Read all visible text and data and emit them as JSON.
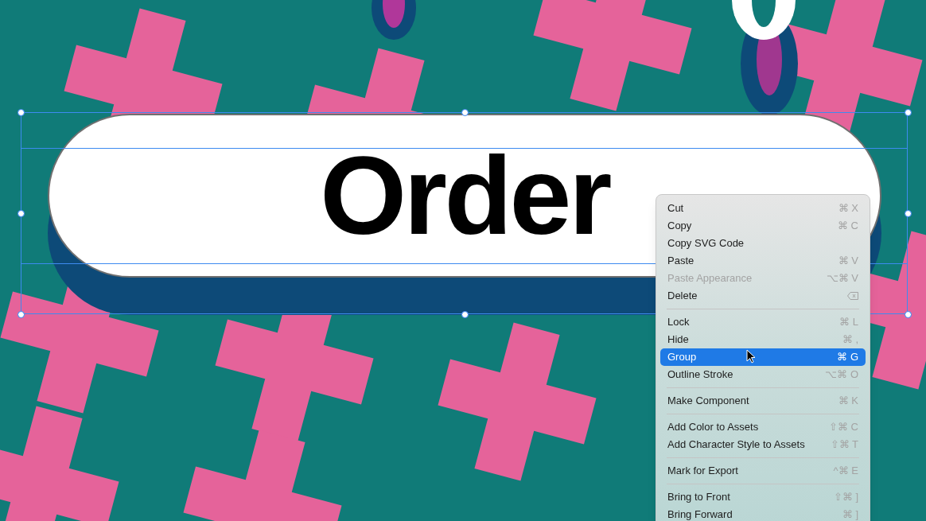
{
  "canvas": {
    "pill_text": "Order"
  },
  "menu": {
    "items": [
      {
        "kind": "item",
        "label": "Cut",
        "shortcut": "⌘ X",
        "disabled": false,
        "selected": false
      },
      {
        "kind": "item",
        "label": "Copy",
        "shortcut": "⌘ C",
        "disabled": false,
        "selected": false
      },
      {
        "kind": "item",
        "label": "Copy SVG Code",
        "disabled": false,
        "selected": false
      },
      {
        "kind": "item",
        "label": "Paste",
        "shortcut": "⌘ V",
        "disabled": false,
        "selected": false
      },
      {
        "kind": "item",
        "label": "Paste Appearance",
        "shortcut": "⌥⌘ V",
        "disabled": true,
        "selected": false
      },
      {
        "kind": "delete-key",
        "label": "Delete",
        "disabled": false,
        "selected": false
      },
      {
        "kind": "separator"
      },
      {
        "kind": "item",
        "label": "Lock",
        "shortcut": "⌘ L",
        "disabled": false,
        "selected": false
      },
      {
        "kind": "item",
        "label": "Hide",
        "shortcut": "⌘ ,",
        "disabled": false,
        "selected": false
      },
      {
        "kind": "item",
        "label": "Group",
        "shortcut": "⌘ G",
        "disabled": false,
        "selected": true
      },
      {
        "kind": "item",
        "label": "Outline Stroke",
        "shortcut": "⌥⌘ O",
        "disabled": false,
        "selected": false
      },
      {
        "kind": "separator"
      },
      {
        "kind": "item",
        "label": "Make Component",
        "shortcut": "⌘ K",
        "disabled": false,
        "selected": false
      },
      {
        "kind": "separator"
      },
      {
        "kind": "item",
        "label": "Add Color to Assets",
        "shortcut": "⇧⌘ C",
        "disabled": false,
        "selected": false
      },
      {
        "kind": "item",
        "label": "Add Character Style to Assets",
        "shortcut": "⇧⌘ T",
        "disabled": false,
        "selected": false
      },
      {
        "kind": "separator"
      },
      {
        "kind": "item",
        "label": "Mark for Export",
        "shortcut": "^⌘ E",
        "disabled": false,
        "selected": false
      },
      {
        "kind": "separator"
      },
      {
        "kind": "item",
        "label": "Bring to Front",
        "shortcut": "⇧⌘ ]",
        "disabled": false,
        "selected": false
      },
      {
        "kind": "item",
        "label": "Bring Forward",
        "shortcut": "⌘ ]",
        "disabled": false,
        "selected": false
      }
    ]
  }
}
